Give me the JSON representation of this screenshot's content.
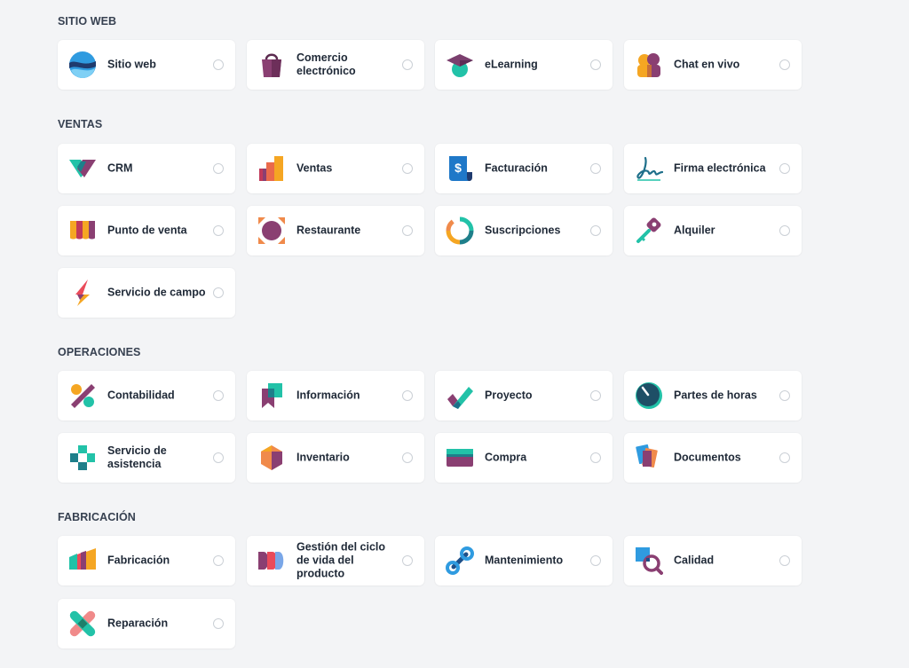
{
  "sections": [
    {
      "title": "SITIO WEB",
      "apps": [
        {
          "label": "Sitio web",
          "icon": "website-icon"
        },
        {
          "label": "Comercio electrónico",
          "icon": "ecommerce-bag-icon"
        },
        {
          "label": "eLearning",
          "icon": "graduation-cap-icon"
        },
        {
          "label": "Chat en vivo",
          "icon": "live-chat-icon"
        }
      ]
    },
    {
      "title": "VENTAS",
      "apps": [
        {
          "label": "CRM",
          "icon": "crm-handshake-icon"
        },
        {
          "label": "Ventas",
          "icon": "sales-chart-icon"
        },
        {
          "label": "Facturación",
          "icon": "invoice-icon"
        },
        {
          "label": "Firma electrónica",
          "icon": "signature-icon"
        },
        {
          "label": "Punto de venta",
          "icon": "shop-awning-icon"
        },
        {
          "label": "Restaurante",
          "icon": "restaurant-icon"
        },
        {
          "label": "Suscripciones",
          "icon": "subscription-cycle-icon"
        },
        {
          "label": "Alquiler",
          "icon": "rental-key-icon"
        },
        {
          "label": "Servicio de campo",
          "icon": "field-service-bolt-icon"
        }
      ]
    },
    {
      "title": "OPERACIONES",
      "apps": [
        {
          "label": "Contabilidad",
          "icon": "accounting-percent-icon"
        },
        {
          "label": "Información",
          "icon": "knowledge-bookmark-icon"
        },
        {
          "label": "Proyecto",
          "icon": "project-check-icon"
        },
        {
          "label": "Partes de horas",
          "icon": "timesheet-clock-icon"
        },
        {
          "label": "Servicio de asistencia",
          "icon": "helpdesk-cross-icon"
        },
        {
          "label": "Inventario",
          "icon": "inventory-box-icon"
        },
        {
          "label": "Compra",
          "icon": "purchase-card-icon"
        },
        {
          "label": "Documentos",
          "icon": "documents-icon"
        }
      ]
    },
    {
      "title": "FABRICACIÓN",
      "apps": [
        {
          "label": "Fabricación",
          "icon": "manufacturing-factory-icon"
        },
        {
          "label": "Gestión del ciclo de vida del producto",
          "icon": "plm-icon"
        },
        {
          "label": "Mantenimiento",
          "icon": "maintenance-wrench-icon"
        },
        {
          "label": "Calidad",
          "icon": "quality-magnifier-icon"
        },
        {
          "label": "Reparación",
          "icon": "repair-bandage-icon"
        }
      ]
    }
  ]
}
